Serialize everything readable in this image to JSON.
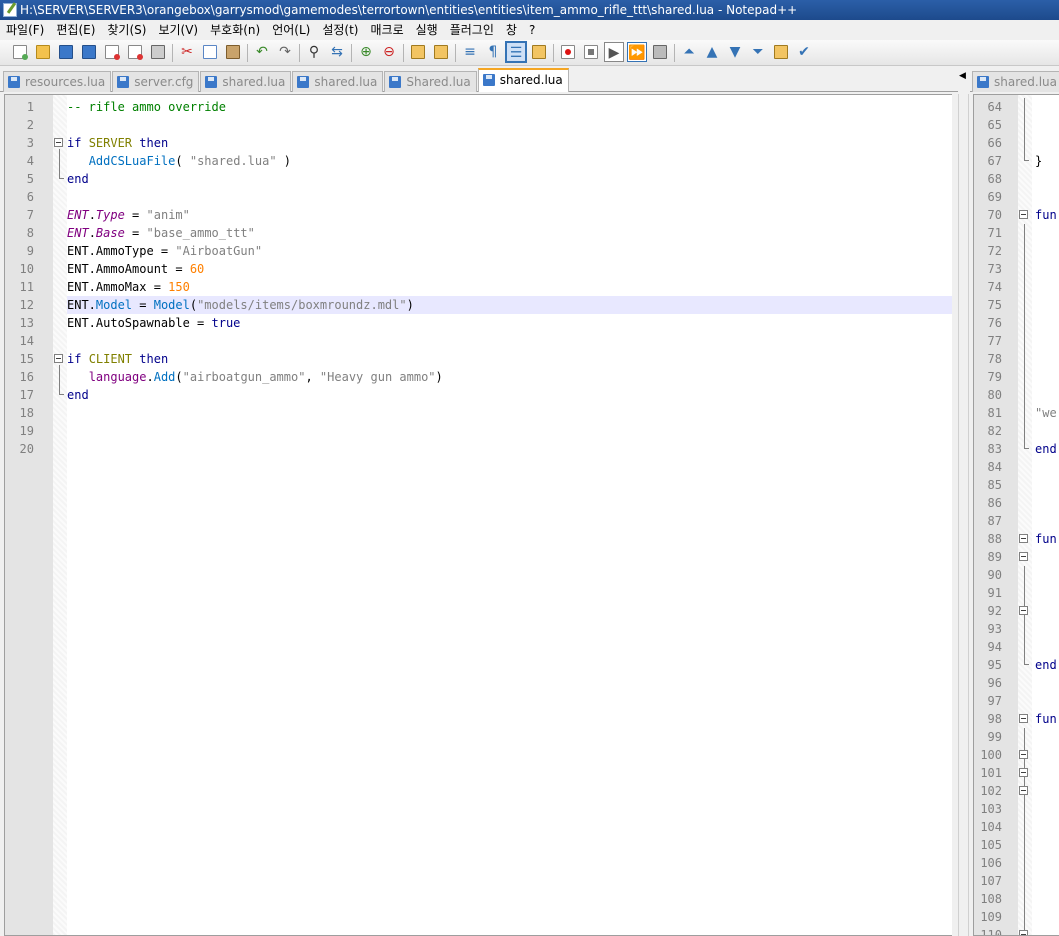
{
  "window": {
    "title": "H:\\SERVER\\SERVER3\\orangebox\\garrysmod\\gamemodes\\terrortown\\entities\\entities\\item_ammo_rifle_ttt\\shared.lua - Notepad++"
  },
  "menu": [
    "파일(F)",
    "편집(E)",
    "찾기(S)",
    "보기(V)",
    "부호화(n)",
    "언어(L)",
    "설정(t)",
    "매크로",
    "실행",
    "플러그인",
    "창",
    "?"
  ],
  "toolbar": {
    "buttons": [
      "new-file",
      "open-file",
      "save",
      "save-all",
      "close",
      "close-all",
      "print",
      "cut",
      "copy",
      "paste",
      "undo",
      "redo",
      "find",
      "replace",
      "zoom-in",
      "zoom-out",
      "sync-vertical",
      "sync-horizontal",
      "word-wrap",
      "show-all-chars",
      "indent-guide",
      "doc-map",
      "record-macro",
      "stop-record",
      "play-macro",
      "run-macro-multiple",
      "save-macro",
      "fold-all",
      "collapse-up",
      "expand-down",
      "unfold-all",
      "spellcheck-launcher",
      "spellcheck"
    ]
  },
  "tabs_left": [
    {
      "label": "resources.lua",
      "active": false
    },
    {
      "label": "server.cfg",
      "active": false
    },
    {
      "label": "shared.lua",
      "active": false
    },
    {
      "label": "shared.lua",
      "active": false
    },
    {
      "label": "Shared.lua",
      "active": false
    },
    {
      "label": "shared.lua",
      "active": true
    }
  ],
  "tabs_right": [
    {
      "label": "shared.lua",
      "active": false
    }
  ],
  "editor_left": {
    "caret_line": 12,
    "lines": [
      {
        "n": "1",
        "tokens": [
          [
            "t-comment",
            "-- rifle ammo override"
          ]
        ]
      },
      {
        "n": "2",
        "tokens": []
      },
      {
        "n": "3",
        "tokens": [
          [
            "t-kw",
            "if"
          ],
          [
            "",
            " "
          ],
          [
            "t-global",
            "SERVER"
          ],
          [
            "",
            " "
          ],
          [
            "t-kw",
            "then"
          ]
        ]
      },
      {
        "n": "4",
        "tokens": [
          [
            "",
            "   "
          ],
          [
            "t-func",
            "AddCSLuaFile"
          ],
          [
            "",
            "( "
          ],
          [
            "t-str",
            "\"shared.lua\""
          ],
          [
            "",
            " )"
          ]
        ]
      },
      {
        "n": "5",
        "tokens": [
          [
            "t-kw",
            "end"
          ]
        ]
      },
      {
        "n": "6",
        "tokens": []
      },
      {
        "n": "7",
        "tokens": [
          [
            "t-italic",
            "ENT"
          ],
          [
            "",
            "."
          ],
          [
            "t-italic",
            "Type"
          ],
          [
            "",
            " = "
          ],
          [
            "t-str",
            "\"anim\""
          ]
        ]
      },
      {
        "n": "8",
        "tokens": [
          [
            "t-italic",
            "ENT"
          ],
          [
            "",
            "."
          ],
          [
            "t-italic",
            "Base"
          ],
          [
            "",
            " = "
          ],
          [
            "t-str",
            "\"base_ammo_ttt\""
          ]
        ]
      },
      {
        "n": "9",
        "tokens": [
          [
            "",
            "ENT.AmmoType = "
          ],
          [
            "t-str",
            "\"AirboatGun\""
          ]
        ]
      },
      {
        "n": "10",
        "tokens": [
          [
            "",
            "ENT.AmmoAmount = "
          ],
          [
            "t-num",
            "60"
          ]
        ]
      },
      {
        "n": "11",
        "tokens": [
          [
            "",
            "ENT.AmmoMax = "
          ],
          [
            "t-num",
            "150"
          ]
        ]
      },
      {
        "n": "12",
        "tokens": [
          [
            "",
            "ENT."
          ],
          [
            "t-prop",
            "Model"
          ],
          [
            "",
            " = "
          ],
          [
            "t-prop",
            "Model"
          ],
          [
            "",
            "("
          ],
          [
            "t-str",
            "\"models/items/boxmroundz.mdl\""
          ],
          [
            "",
            ")"
          ]
        ]
      },
      {
        "n": "13",
        "tokens": [
          [
            "",
            "ENT.AutoSpawnable = "
          ],
          [
            "t-kw",
            "true"
          ]
        ]
      },
      {
        "n": "14",
        "tokens": []
      },
      {
        "n": "15",
        "tokens": [
          [
            "t-kw",
            "if"
          ],
          [
            "",
            " "
          ],
          [
            "t-global",
            "CLIENT"
          ],
          [
            "",
            " "
          ],
          [
            "t-kw",
            "then"
          ]
        ]
      },
      {
        "n": "16",
        "tokens": [
          [
            "",
            "   "
          ],
          [
            "t-lang",
            "language"
          ],
          [
            "",
            "."
          ],
          [
            "t-func",
            "Add"
          ],
          [
            "",
            "("
          ],
          [
            "t-str",
            "\"airboatgun_ammo\""
          ],
          [
            "",
            ", "
          ],
          [
            "t-str",
            "\"Heavy gun ammo\""
          ],
          [
            "",
            ")"
          ]
        ]
      },
      {
        "n": "17",
        "tokens": [
          [
            "t-kw",
            "end"
          ]
        ]
      },
      {
        "n": "18",
        "tokens": []
      },
      {
        "n": "19",
        "tokens": []
      },
      {
        "n": "20",
        "tokens": []
      }
    ]
  },
  "editor_right": {
    "lines": [
      {
        "n": "64",
        "text": ""
      },
      {
        "n": "65",
        "text": ""
      },
      {
        "n": "66",
        "text": ""
      },
      {
        "n": "67",
        "text": "}"
      },
      {
        "n": "68",
        "text": ""
      },
      {
        "n": "69",
        "text": ""
      },
      {
        "n": "70",
        "text": "fun"
      },
      {
        "n": "71",
        "text": ""
      },
      {
        "n": "72",
        "text": ""
      },
      {
        "n": "73",
        "text": ""
      },
      {
        "n": "74",
        "text": ""
      },
      {
        "n": "75",
        "text": ""
      },
      {
        "n": "76",
        "text": ""
      },
      {
        "n": "77",
        "text": ""
      },
      {
        "n": "78",
        "text": ""
      },
      {
        "n": "79",
        "text": ""
      },
      {
        "n": "80",
        "text": ""
      },
      {
        "n": "81",
        "text": "\"we"
      },
      {
        "n": "82",
        "text": ""
      },
      {
        "n": "83",
        "text": "end"
      },
      {
        "n": "84",
        "text": ""
      },
      {
        "n": "85",
        "text": ""
      },
      {
        "n": "86",
        "text": ""
      },
      {
        "n": "87",
        "text": ""
      },
      {
        "n": "88",
        "text": "fun"
      },
      {
        "n": "89",
        "text": ""
      },
      {
        "n": "90",
        "text": ""
      },
      {
        "n": "91",
        "text": ""
      },
      {
        "n": "92",
        "text": ""
      },
      {
        "n": "93",
        "text": ""
      },
      {
        "n": "94",
        "text": ""
      },
      {
        "n": "95",
        "text": "end"
      },
      {
        "n": "96",
        "text": ""
      },
      {
        "n": "97",
        "text": ""
      },
      {
        "n": "98",
        "text": "fun"
      },
      {
        "n": "99",
        "text": ""
      },
      {
        "n": "100",
        "text": ""
      },
      {
        "n": "101",
        "text": ""
      },
      {
        "n": "102",
        "text": ""
      },
      {
        "n": "103",
        "text": ""
      },
      {
        "n": "104",
        "text": ""
      },
      {
        "n": "105",
        "text": ""
      },
      {
        "n": "106",
        "text": ""
      },
      {
        "n": "107",
        "text": ""
      },
      {
        "n": "108",
        "text": ""
      },
      {
        "n": "109",
        "text": ""
      },
      {
        "n": "110",
        "text": ""
      }
    ]
  }
}
